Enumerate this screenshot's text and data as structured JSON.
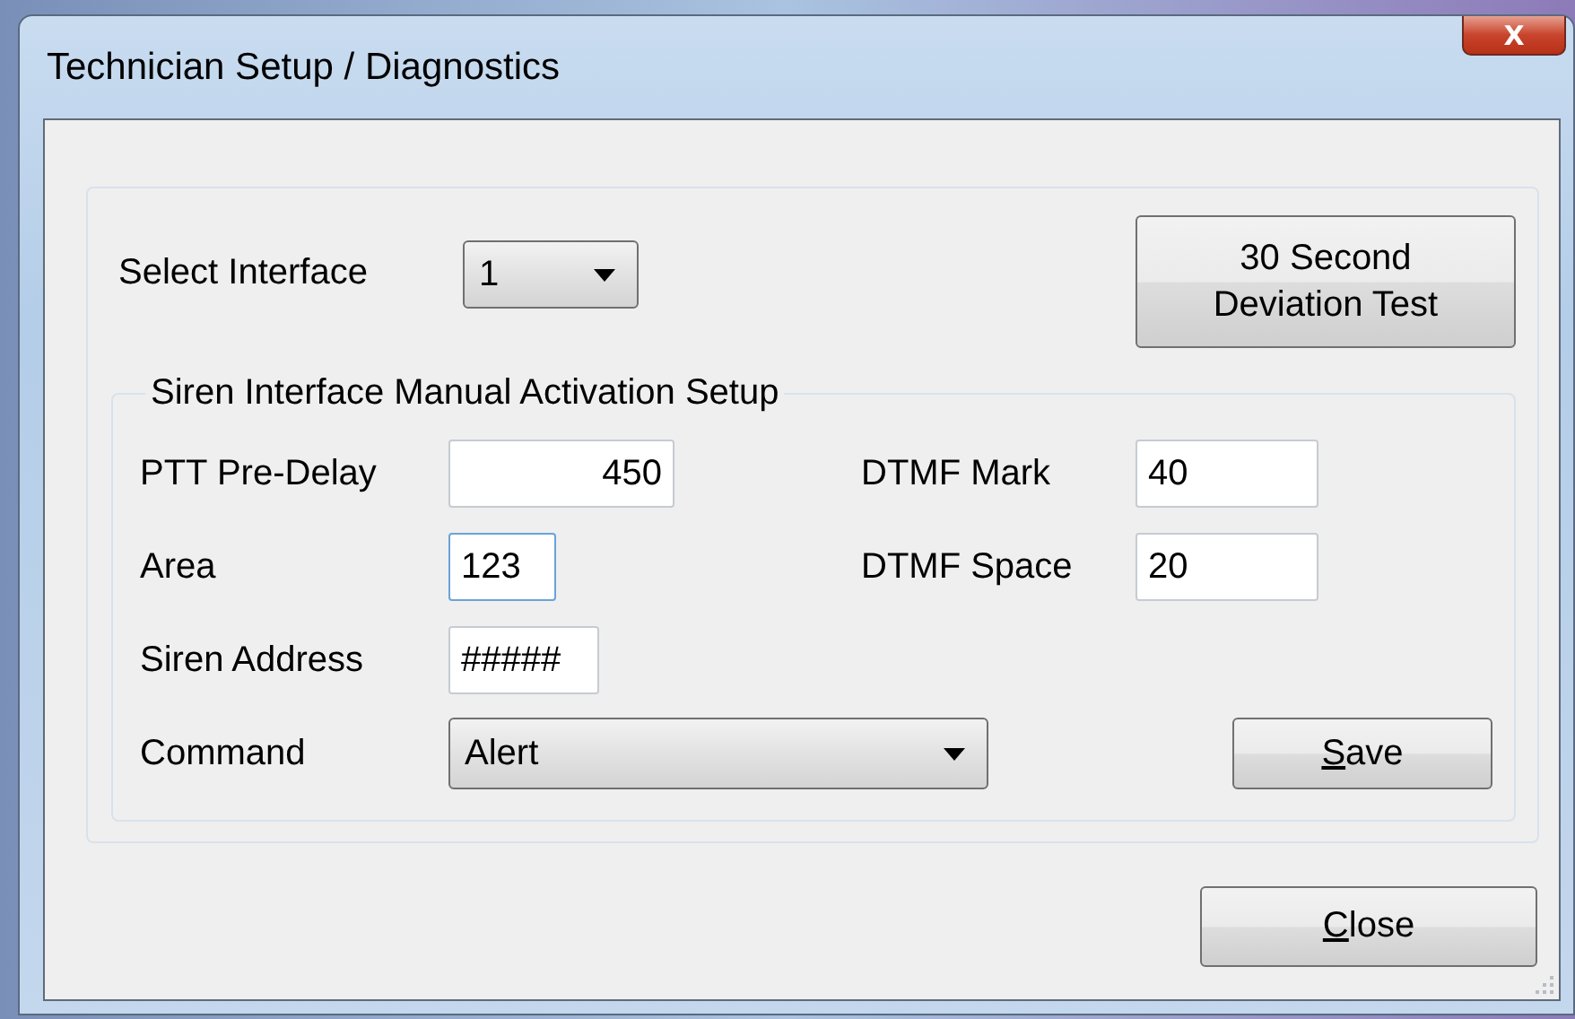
{
  "window": {
    "title": "Technician Setup / Diagnostics",
    "close_button": {
      "label": "X"
    }
  },
  "select_interface": {
    "label": "Select Interface",
    "value": "1"
  },
  "deviation_test_button": {
    "label": "30 Second Deviation Test"
  },
  "group": {
    "title": "Siren Interface Manual Activation Setup",
    "fields": [
      {
        "label": "PTT Pre-Delay",
        "value": "450",
        "focused": false
      },
      {
        "label": "DTMF Mark",
        "value": "40",
        "focused": false
      },
      {
        "label": "Area",
        "value": "123",
        "focused": true
      },
      {
        "label": "DTMF Space",
        "value": "20",
        "focused": false
      },
      {
        "label": "Siren Address",
        "value": "#####",
        "focused": false
      }
    ],
    "command": {
      "label": "Command",
      "value": "Alert"
    },
    "save_button": {
      "label": "Save"
    }
  },
  "close_button": {
    "label": "Close"
  }
}
